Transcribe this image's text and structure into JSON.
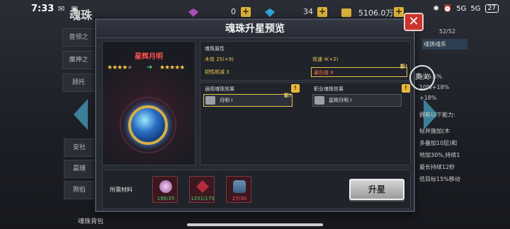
{
  "status_bar": {
    "time": "7:33",
    "network_a": "5G",
    "network_b": "5G",
    "battery": "27"
  },
  "background": {
    "title": "魂珠",
    "resources": [
      {
        "value": "0"
      },
      {
        "value": "34"
      },
      {
        "value": "5106.0万"
      }
    ],
    "left_tabs": [
      "兽领之",
      "魔神之",
      "顾托",
      "安社",
      "晨珊",
      "刚伯"
    ],
    "right_panel": [
      "52/52",
      "魂铸魂系",
      "+16.5%",
      "10%+18%",
      "+18%",
      "拥有以下能力:",
      "标并施加(木",
      "多叠加10层)和",
      "地加30%,持续1",
      "最长持续12秒",
      "低目标15%移动"
    ],
    "bag_label": "魂珠背包"
  },
  "modal": {
    "title": "魂珠升星预览",
    "jewel": {
      "name": "星辉月明",
      "stars_before": 4,
      "stars_after": 5
    },
    "attributes": {
      "section_label": "魂珠属性",
      "left": [
        "木攻 25(+9)",
        "韧性削减 3"
      ],
      "right": [
        "攻速 4(+2)",
        "暴伤值 8"
      ],
      "new_tag": "新!"
    },
    "effects": {
      "general_label": "通用魂珠效果",
      "general_item": "月明 I",
      "general_new": "新!",
      "class_label": "职业魂珠效果",
      "class_item": "星辉月明 I"
    },
    "materials": {
      "label": "所需材料",
      "items": [
        {
          "icon": "crystal-orb-icon",
          "count": "196/35",
          "status": "ok"
        },
        {
          "icon": "red-gem-icon",
          "count": "1201/170",
          "status": "ok"
        },
        {
          "icon": "potion-jar-icon",
          "count": "27/30",
          "status": "bad"
        }
      ]
    },
    "upgrade_label": "升星",
    "close_label": "✕"
  },
  "side_button_label": "奥义",
  "colors": {
    "accent_gold": "#e8c44a",
    "close_red": "#c9342e",
    "ok_green": "#45d36a",
    "bad_red": "#ff5757",
    "name_red": "#ff5151"
  }
}
